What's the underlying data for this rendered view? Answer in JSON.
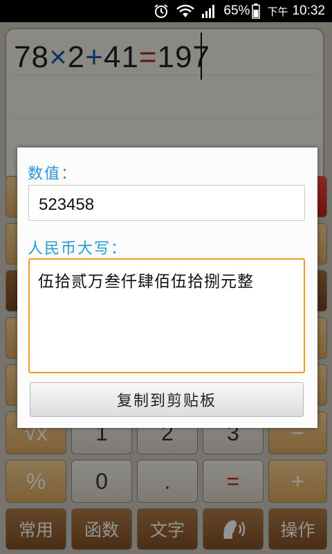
{
  "status_bar": {
    "battery": "65%",
    "ampm": "下午",
    "time": "10:32",
    "icons": [
      "alarm-icon",
      "wifi-icon",
      "signal-icon",
      "battery-icon"
    ]
  },
  "display": {
    "expression": [
      {
        "text": "78",
        "kind": "num"
      },
      {
        "text": "×",
        "kind": "op"
      },
      {
        "text": "2",
        "kind": "num"
      },
      {
        "text": "+",
        "kind": "op"
      },
      {
        "text": "41",
        "kind": "num"
      },
      {
        "text": "=",
        "kind": "eq"
      },
      {
        "text": "197",
        "kind": "num"
      }
    ]
  },
  "keypad": {
    "row1": [
      "√x",
      "1",
      "2",
      "3",
      "−"
    ],
    "row2": [
      "%",
      "0",
      ".",
      "=",
      "+"
    ],
    "bottom": [
      "常用",
      "函数",
      "文字",
      "",
      "操作"
    ]
  },
  "dialog": {
    "value_label": "数值：",
    "value": "523458",
    "rmb_label": "人民币大写：",
    "rmb_words": "伍拾贰万叁仟肆佰伍拾捌元整",
    "copy_button": "复制到剪贴板"
  },
  "colors": {
    "accent_label": "#2499d5",
    "focus_border": "#f09a1f",
    "operator_blue": "#1c56a8",
    "equals_red": "#b5271f"
  }
}
